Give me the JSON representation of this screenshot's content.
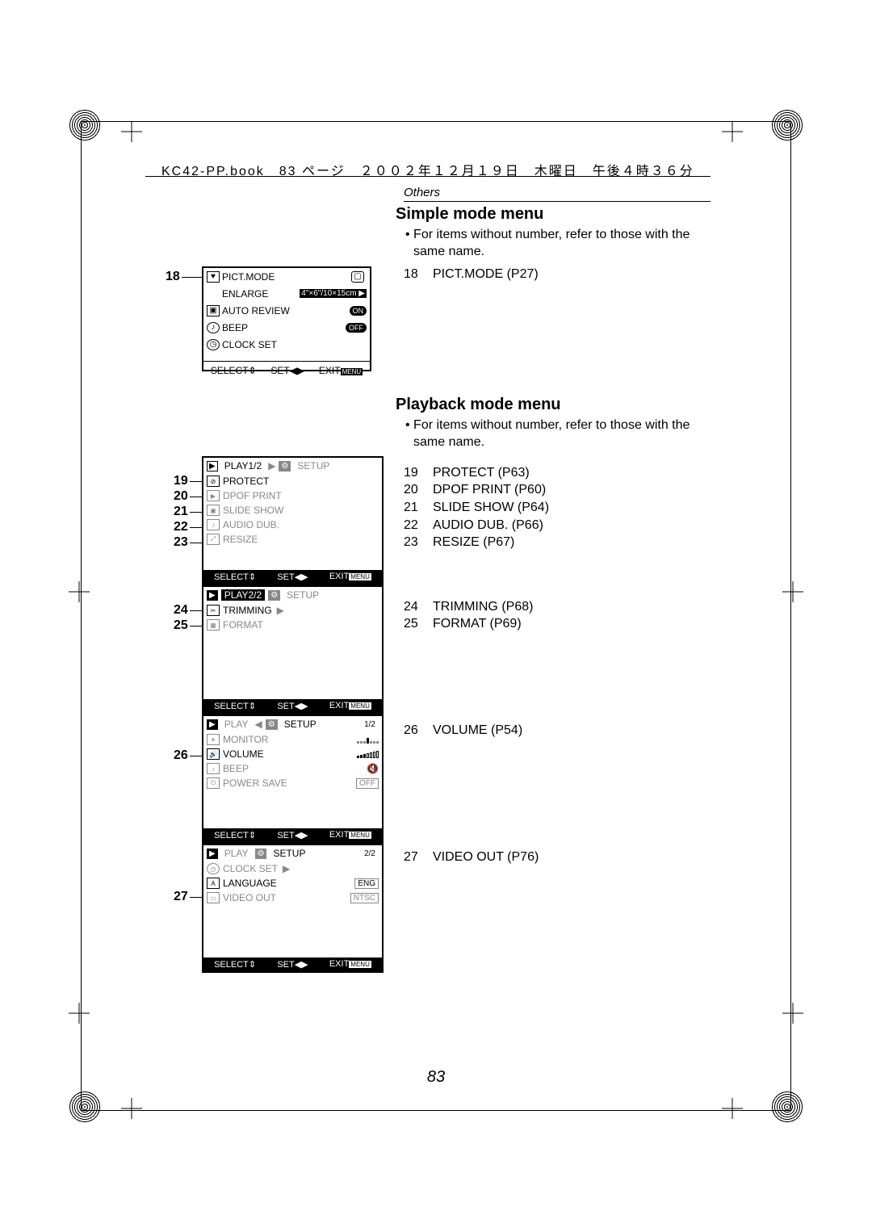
{
  "header": {
    "line": "KC42-PP.book　83 ページ　２００２年１２月１９日　木曜日　午後４時３６分"
  },
  "section_label": "Others",
  "page_number": "83",
  "simple_mode": {
    "heading": "Simple mode menu",
    "note": "• For items without number, refer to those with the same name.",
    "refs": [
      {
        "n": "18",
        "txt": "PICT.MODE (P27)"
      }
    ],
    "callout_num": "18",
    "screen": {
      "rows": [
        {
          "icon": "heart",
          "label": "PICT.MODE",
          "val": ""
        },
        {
          "icon": "",
          "label": "ENLARGE",
          "val": "4\"×6\"/10×15cm ▶"
        },
        {
          "icon": "box",
          "label": "AUTO REVIEW",
          "val": "ON",
          "pill": true
        },
        {
          "icon": "beep",
          "label": "BEEP",
          "val": "OFF",
          "pill": true
        },
        {
          "icon": "clock",
          "label": "CLOCK SET",
          "val": ""
        }
      ],
      "nav": {
        "select": "SELECT",
        "set": "SET",
        "exit": "EXIT",
        "menu": "MENU"
      }
    }
  },
  "playback_mode": {
    "heading": "Playback mode menu",
    "note": "• For items without number, refer to those with the same name.",
    "refs1": [
      {
        "n": "19",
        "txt": "PROTECT (P63)"
      },
      {
        "n": "20",
        "txt": "DPOF PRINT (P60)"
      },
      {
        "n": "21",
        "txt": "SLIDE SHOW (P64)"
      },
      {
        "n": "22",
        "txt": "AUDIO DUB. (P66)"
      },
      {
        "n": "23",
        "txt": "RESIZE (P67)"
      }
    ],
    "refs2": [
      {
        "n": "24",
        "txt": "TRIMMING (P68)"
      },
      {
        "n": "25",
        "txt": "FORMAT (P69)"
      }
    ],
    "refs3": [
      {
        "n": "26",
        "txt": "VOLUME (P54)"
      }
    ],
    "refs4": [
      {
        "n": "27",
        "txt": "VIDEO OUT (P76)"
      }
    ],
    "screens": {
      "s1": {
        "tabs": {
          "play": "PLAY1/2",
          "setup": "SETUP"
        },
        "rows": [
          {
            "label": "PROTECT"
          },
          {
            "label": "DPOF PRINT"
          },
          {
            "label": "SLIDE SHOW"
          },
          {
            "label": "AUDIO DUB."
          },
          {
            "label": "RESIZE"
          }
        ]
      },
      "s2": {
        "tabs": {
          "play": "PLAY2/2",
          "setup": "SETUP"
        },
        "rows": [
          {
            "label": "TRIMMING"
          },
          {
            "label": "FORMAT"
          }
        ]
      },
      "s3": {
        "tabs": {
          "play": "PLAY",
          "setup": "SETUP",
          "page": "1/2"
        },
        "rows": [
          {
            "label": "MONITOR",
            "val": "bars"
          },
          {
            "label": "VOLUME",
            "val": "bars2"
          },
          {
            "label": "BEEP",
            "val": "mute"
          },
          {
            "label": "POWER SAVE",
            "val": "OFF"
          }
        ]
      },
      "s4": {
        "tabs": {
          "play": "PLAY",
          "setup": "SETUP",
          "page": "2/2"
        },
        "rows": [
          {
            "label": "CLOCK SET",
            "val": "▶"
          },
          {
            "label": "LANGUAGE",
            "val": "ENG"
          },
          {
            "label": "VIDEO OUT",
            "val": "NTSC"
          }
        ]
      },
      "footer": {
        "select": "SELECT",
        "set": "SET",
        "exit": "EXIT",
        "menu": "MENU"
      }
    },
    "callouts": {
      "c19": "19",
      "c20": "20",
      "c21": "21",
      "c22": "22",
      "c23": "23",
      "c24": "24",
      "c25": "25",
      "c26": "26",
      "c27": "27"
    }
  }
}
